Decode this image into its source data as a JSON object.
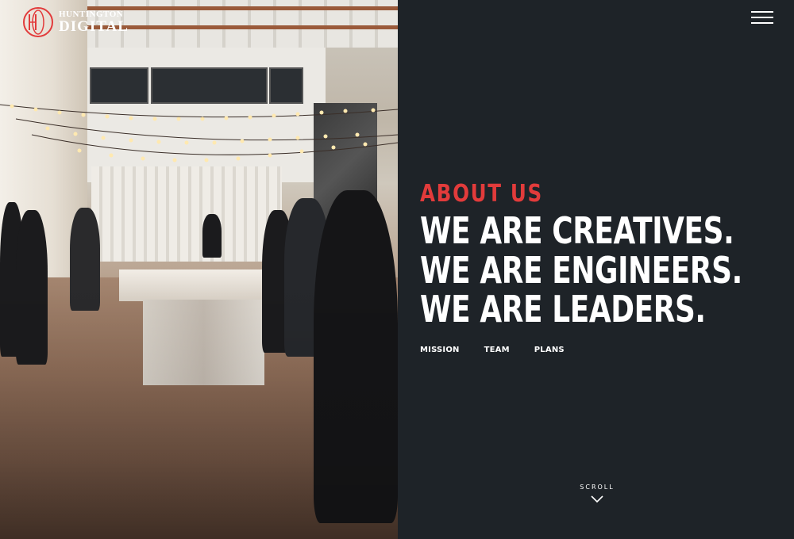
{
  "brand": {
    "logo_line1": "HUNTINGTON",
    "logo_line2": "DIGITAL",
    "mark": "HD",
    "accent_color": "#e23b3b"
  },
  "hero": {
    "eyebrow": "ABOUT US",
    "lines": [
      "WE ARE CREATIVES.",
      "WE ARE ENGINEERS.",
      "WE ARE LEADERS."
    ]
  },
  "nav": {
    "items": [
      "MISSION",
      "TEAM",
      "PLANS"
    ]
  },
  "scroll": {
    "label": "SCROLL",
    "icon": "chevron-down-icon"
  },
  "menu": {
    "icon": "hamburger-menu-icon"
  },
  "photo": {
    "description_icon": "event-photo"
  }
}
